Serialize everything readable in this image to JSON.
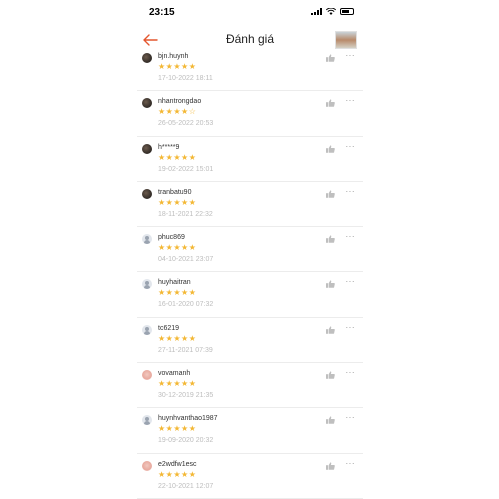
{
  "status": {
    "time": "23:15"
  },
  "nav": {
    "title": "Đánh giá"
  },
  "colors": {
    "accent": "#e4572e",
    "star": "#f3b733",
    "date": "#bdbdbd"
  },
  "reviews": [
    {
      "user": "bjn.huynh",
      "stars": 5,
      "date": "17-10-2022 18:11",
      "avatar": "photo"
    },
    {
      "user": "nhantrongdao",
      "stars": 4,
      "date": "26-05-2022 20:53",
      "avatar": "photo"
    },
    {
      "user": "h*****9",
      "stars": 5,
      "date": "19-02-2022 15:01",
      "avatar": "photo"
    },
    {
      "user": "tranbatu90",
      "stars": 5,
      "date": "18-11-2021 22:32",
      "avatar": "photo"
    },
    {
      "user": "phuc869",
      "stars": 5,
      "date": "04-10-2021 23:07",
      "avatar": "generic"
    },
    {
      "user": "huyhaitran",
      "stars": 5,
      "date": "16-01-2020 07:32",
      "avatar": "generic"
    },
    {
      "user": "tc6219",
      "stars": 5,
      "date": "27-11-2021 07:39",
      "avatar": "generic"
    },
    {
      "user": "vovamanh",
      "stars": 5,
      "date": "30-12-2019 21:35",
      "avatar": "pink"
    },
    {
      "user": "huynhvanthao1987",
      "stars": 5,
      "date": "19-09-2020 20:32",
      "avatar": "generic"
    },
    {
      "user": "e2wdfw1esc",
      "stars": 5,
      "date": "22-10-2021 12:07",
      "avatar": "pink"
    }
  ]
}
